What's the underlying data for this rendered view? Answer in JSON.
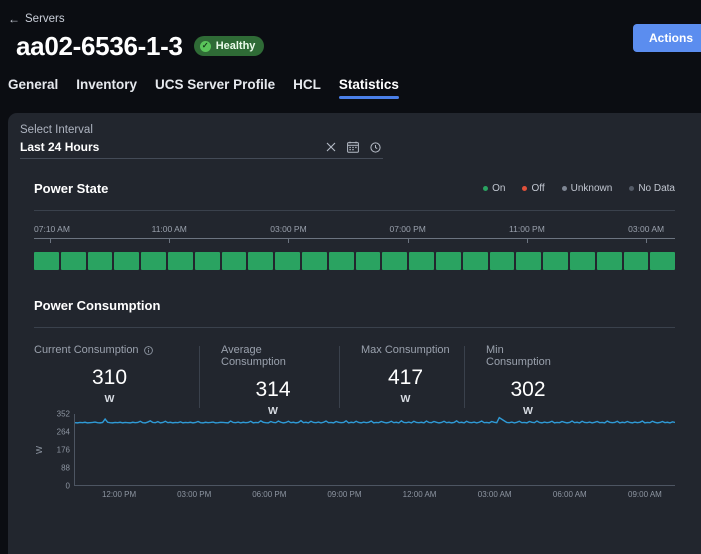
{
  "header": {
    "breadcrumb": "Servers",
    "breadcrumb_icon": "arrow-left-icon",
    "title": "aa02-6536-1-3",
    "status_badge": "Healthy",
    "status_color": "#2f6b36",
    "actions_label": "Actions",
    "actions_color": "#5b8def"
  },
  "tabs": [
    {
      "label": "General",
      "active": false
    },
    {
      "label": "Inventory",
      "active": false
    },
    {
      "label": "UCS Server Profile",
      "active": false
    },
    {
      "label": "HCL",
      "active": false
    },
    {
      "label": "Statistics",
      "active": true
    }
  ],
  "interval": {
    "label": "Select Interval",
    "value": "Last 24 Hours",
    "placeholder": "Select Interval",
    "clear_icon": "close-icon",
    "calendar_icon": "calendar-icon",
    "clock_icon": "clock-icon"
  },
  "power_state": {
    "title": "Power State",
    "legend": [
      {
        "label": "On",
        "color": "#2aa361"
      },
      {
        "label": "Off",
        "color": "#e0503a"
      },
      {
        "label": "Unknown",
        "color": "#7e8693"
      },
      {
        "label": "No Data",
        "color": "#555c68"
      }
    ],
    "time_ticks": [
      "07:10 AM",
      "11:00 AM",
      "03:00 PM",
      "07:00 PM",
      "11:00 PM",
      "03:00 AM"
    ],
    "segments": [
      "On",
      "On",
      "On",
      "On",
      "On",
      "On",
      "On",
      "On",
      "On",
      "On",
      "On",
      "On",
      "On",
      "On",
      "On",
      "On",
      "On",
      "On",
      "On",
      "On",
      "On",
      "On",
      "On",
      "On"
    ]
  },
  "power_consumption": {
    "title": "Power Consumption",
    "stats": [
      {
        "label": "Current Consumption",
        "value": "310",
        "unit": "W",
        "has_info_icon": true
      },
      {
        "label": "Average Consumption",
        "value": "314",
        "unit": "W",
        "has_info_icon": false
      },
      {
        "label": "Max Consumption",
        "value": "417",
        "unit": "W",
        "has_info_icon": false
      },
      {
        "label": "Min Consumption",
        "value": "302",
        "unit": "W",
        "has_info_icon": false
      }
    ]
  },
  "chart_data": {
    "type": "line",
    "title": "Power Consumption",
    "xlabel": "",
    "ylabel": "W",
    "ylim": [
      0,
      352
    ],
    "yticks": [
      352,
      264,
      176,
      88,
      0
    ],
    "xticks": [
      "12:00 PM",
      "03:00 PM",
      "06:00 PM",
      "09:00 PM",
      "12:00 AM",
      "03:00 AM",
      "06:00 AM",
      "09:00 AM"
    ],
    "grid": false,
    "legend": "none",
    "line_color": "#2f9ad6",
    "series": [
      {
        "name": "Power Consumption (W)",
        "unit": "W",
        "values": [
          309,
          308,
          310,
          309,
          311,
          308,
          309,
          310,
          312,
          309,
          308,
          310,
          327,
          311,
          309,
          308,
          310,
          309,
          311,
          308,
          310,
          309,
          308,
          311,
          309,
          310,
          316,
          309,
          308,
          312,
          318,
          310,
          309,
          314,
          308,
          310,
          316,
          309,
          311,
          308,
          310,
          309,
          313,
          308,
          310,
          309,
          311,
          308,
          310,
          315,
          309,
          308,
          311,
          309,
          310,
          312,
          308,
          309,
          311,
          310,
          309,
          308,
          317,
          310,
          309,
          312,
          308,
          311,
          309,
          310,
          316,
          308,
          310,
          309,
          318,
          311,
          309,
          308,
          315,
          310,
          309,
          317,
          311,
          308,
          310,
          316,
          309,
          311,
          308,
          310,
          319,
          309,
          311,
          308,
          316,
          310,
          309,
          312,
          308,
          311,
          317,
          309,
          310,
          308,
          315,
          311,
          309,
          310,
          318,
          308,
          311,
          309,
          316,
          310,
          308,
          312,
          309,
          311,
          317,
          308,
          310,
          309,
          315,
          311,
          308,
          310,
          316,
          309,
          311,
          308,
          318,
          310,
          309,
          312,
          308,
          316,
          310,
          309,
          311,
          308,
          317,
          310,
          309,
          315,
          311,
          308,
          310,
          316,
          309,
          311,
          308,
          310,
          318,
          309,
          311,
          308,
          316,
          310,
          309,
          312,
          308,
          311,
          317,
          309,
          310,
          308,
          315,
          311,
          309,
          334,
          326,
          318,
          310,
          309,
          312,
          308,
          311,
          316,
          309,
          310,
          308,
          315,
          311,
          309,
          317,
          310,
          308,
          312,
          309,
          311,
          316,
          308,
          310,
          309,
          315,
          311,
          308,
          310,
          317,
          309,
          311,
          308,
          316,
          310,
          309,
          312,
          308,
          311,
          315,
          309,
          310,
          308,
          317,
          311,
          309,
          310,
          316,
          308,
          311,
          309,
          315,
          310,
          308,
          312,
          309,
          311,
          317,
          308,
          310,
          309,
          316,
          311,
          308,
          310,
          315,
          309,
          311,
          308,
          313,
          310
        ]
      }
    ]
  }
}
